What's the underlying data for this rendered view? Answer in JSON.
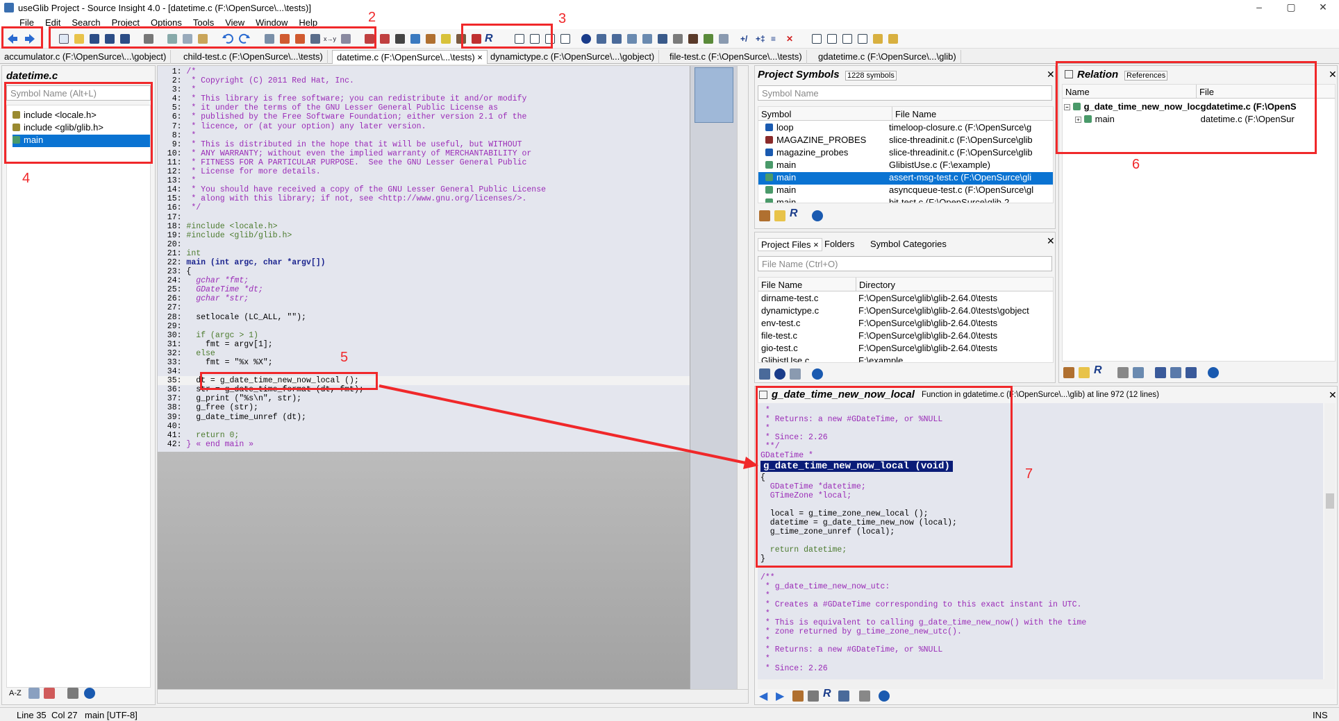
{
  "window": {
    "title": "useGlib Project - Source Insight 4.0 - [datetime.c (F:\\OpenSurce\\...\\tests)]",
    "controls": [
      "–",
      "▢",
      "✕"
    ]
  },
  "menu": [
    "File",
    "Edit",
    "Search",
    "Project",
    "Options",
    "Tools",
    "View",
    "Window",
    "Help"
  ],
  "annotations": {
    "n1": "1",
    "n2": "2",
    "n3": "3",
    "n4": "4",
    "n5": "5",
    "n6": "6",
    "n7": "7"
  },
  "tabs": [
    "accumulator.c (F:\\OpenSurce\\...\\gobject)",
    "child-test.c (F:\\OpenSurce\\...\\tests)",
    "datetime.c (F:\\OpenSurce\\...\\tests) ×",
    "dynamictype.c (F:\\OpenSurce\\...\\gobject)",
    "file-test.c (F:\\OpenSurce\\...\\tests)",
    "gdatetime.c (F:\\OpenSurce\\...\\glib)"
  ],
  "symbol_window": {
    "title": "datetime.c",
    "placeholder": "Symbol Name (Alt+L)",
    "items": [
      "include <locale.h>",
      "include <glib/glib.h>",
      "main"
    ],
    "bottom_sort": "A-Z"
  },
  "editor": {
    "lines": [
      "/*",
      " * Copyright (C) 2011 Red Hat, Inc.",
      " *",
      " * This library is free software; you can redistribute it and/or modify",
      " * it under the terms of the GNU Lesser General Public License as",
      " * published by the Free Software Foundation; either version 2.1 of the",
      " * licence, or (at your option) any later version.",
      " *",
      " * This is distributed in the hope that it will be useful, but WITHOUT",
      " * ANY WARRANTY; without even the implied warranty of MERCHANTABILITY or",
      " * FITNESS FOR A PARTICULAR PURPOSE.  See the GNU Lesser General Public",
      " * License for more details.",
      " *",
      " * You should have received a copy of the GNU Lesser General Public License",
      " * along with this library; if not, see <http://www.gnu.org/licenses/>.",
      " */",
      "",
      "#include <locale.h>",
      "#include <glib/glib.h>",
      "",
      "int",
      "main (int argc, char *argv[])",
      "{",
      "  gchar *fmt;",
      "  GDateTime *dt;",
      "  gchar *str;",
      "",
      "  setlocale (LC_ALL, \"\");",
      "",
      "  if (argc > 1)",
      "    fmt = argv[1];",
      "  else",
      "    fmt = \"%x %X\";",
      "",
      "  dt = g_date_time_new_now_local ();",
      "  str = g_date_time_format (dt, fmt);",
      "  g_print (\"%s\\n\", str);",
      "  g_free (str);",
      "  g_date_time_unref (dt);",
      "",
      "  return 0;",
      "} « end main »"
    ]
  },
  "project_symbols": {
    "title": "Project Symbols",
    "count": "1228 symbols",
    "placeholder": "Symbol Name",
    "columns": [
      "Symbol",
      "File Name"
    ],
    "rows": [
      {
        "symbol": "loop",
        "file": "timeloop-closure.c (F:\\OpenSurce\\g"
      },
      {
        "symbol": "MAGAZINE_PROBES",
        "file": "slice-threadinit.c (F:\\OpenSurce\\glib"
      },
      {
        "symbol": "magazine_probes",
        "file": "slice-threadinit.c (F:\\OpenSurce\\glib"
      },
      {
        "symbol": "main",
        "file": "GlibistUse.c (F:\\example)"
      },
      {
        "symbol": "main",
        "file": "assert-msg-test.c (F:\\OpenSurce\\gli"
      },
      {
        "symbol": "main",
        "file": "asyncqueue-test.c (F:\\OpenSurce\\gl"
      },
      {
        "symbol": "main",
        "file": "bit-test.c (F:\\OpenSurce\\glib-2"
      }
    ]
  },
  "project_files": {
    "tabs": [
      "Project Files ×",
      "Folders",
      "Symbol Categories"
    ],
    "placeholder": "File Name (Ctrl+O)",
    "columns": [
      "File Name",
      "Directory"
    ],
    "rows": [
      {
        "name": "dirname-test.c",
        "dir": "F:\\OpenSurce\\glib\\glib-2.64.0\\tests"
      },
      {
        "name": "dynamictype.c",
        "dir": "F:\\OpenSurce\\glib\\glib-2.64.0\\tests\\gobject"
      },
      {
        "name": "env-test.c",
        "dir": "F:\\OpenSurce\\glib\\glib-2.64.0\\tests"
      },
      {
        "name": "file-test.c",
        "dir": "F:\\OpenSurce\\glib\\glib-2.64.0\\tests"
      },
      {
        "name": "gio-test.c",
        "dir": "F:\\OpenSurce\\glib\\glib-2.64.0\\tests"
      },
      {
        "name": "GlibistUse.c",
        "dir": "F:\\example"
      }
    ]
  },
  "relation": {
    "title": "Relation",
    "mode": "References",
    "columns": [
      "Name",
      "File"
    ],
    "rows": [
      {
        "name": "g_date_time_new_now_loca",
        "file": "gdatetime.c (F:\\OpenS"
      },
      {
        "name": "main",
        "file": "datetime.c (F:\\OpenSur"
      }
    ]
  },
  "context": {
    "symbol": "g_date_time_new_now_local",
    "info": "Function in gdatetime.c (F:\\OpenSurce\\...\\glib) at line 972 (12 lines)",
    "lines": [
      " *",
      " * Returns: a new #GDateTime, or %NULL",
      " *",
      " * Since: 2.26",
      " **/",
      "GDateTime *",
      "g_date_time_new_now_local (void)",
      "{",
      "  GDateTime *datetime;",
      "  GTimeZone *local;",
      "",
      "  local = g_time_zone_new_local ();",
      "  datetime = g_date_time_new_now (local);",
      "  g_time_zone_unref (local);",
      "",
      "  return datetime;",
      "}",
      "",
      "/**",
      " * g_date_time_new_now_utc:",
      " *",
      " * Creates a #GDateTime corresponding to this exact instant in UTC.",
      " *",
      " * This is equivalent to calling g_date_time_new_now() with the time",
      " * zone returned by g_time_zone_new_utc().",
      " *",
      " * Returns: a new #GDateTime, or %NULL",
      " *",
      " * Since: 2.26"
    ]
  },
  "status": {
    "line": "Line 35",
    "col": "Col 27",
    "scope": "main [UTF-8]",
    "mode": "INS"
  }
}
